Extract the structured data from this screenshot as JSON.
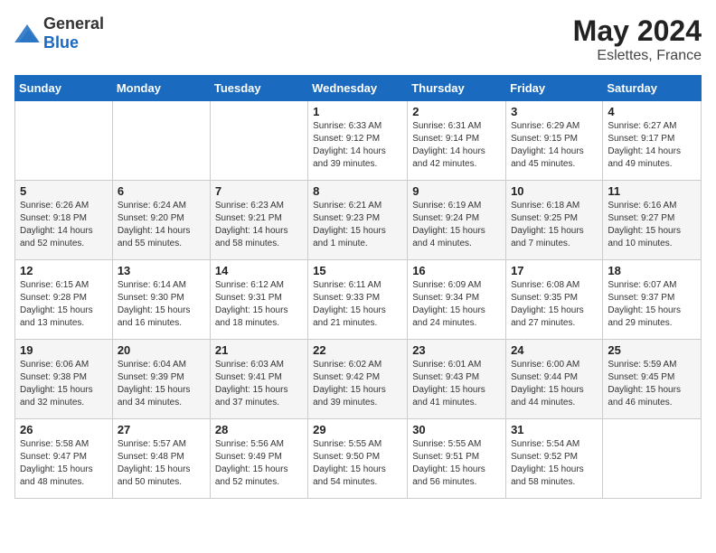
{
  "header": {
    "logo_general": "General",
    "logo_blue": "Blue",
    "title": "May 2024",
    "location": "Eslettes, France"
  },
  "days_of_week": [
    "Sunday",
    "Monday",
    "Tuesday",
    "Wednesday",
    "Thursday",
    "Friday",
    "Saturday"
  ],
  "weeks": [
    [
      {
        "day": "",
        "info": ""
      },
      {
        "day": "",
        "info": ""
      },
      {
        "day": "",
        "info": ""
      },
      {
        "day": "1",
        "info": "Sunrise: 6:33 AM\nSunset: 9:12 PM\nDaylight: 14 hours and 39 minutes."
      },
      {
        "day": "2",
        "info": "Sunrise: 6:31 AM\nSunset: 9:14 PM\nDaylight: 14 hours and 42 minutes."
      },
      {
        "day": "3",
        "info": "Sunrise: 6:29 AM\nSunset: 9:15 PM\nDaylight: 14 hours and 45 minutes."
      },
      {
        "day": "4",
        "info": "Sunrise: 6:27 AM\nSunset: 9:17 PM\nDaylight: 14 hours and 49 minutes."
      }
    ],
    [
      {
        "day": "5",
        "info": "Sunrise: 6:26 AM\nSunset: 9:18 PM\nDaylight: 14 hours and 52 minutes."
      },
      {
        "day": "6",
        "info": "Sunrise: 6:24 AM\nSunset: 9:20 PM\nDaylight: 14 hours and 55 minutes."
      },
      {
        "day": "7",
        "info": "Sunrise: 6:23 AM\nSunset: 9:21 PM\nDaylight: 14 hours and 58 minutes."
      },
      {
        "day": "8",
        "info": "Sunrise: 6:21 AM\nSunset: 9:23 PM\nDaylight: 15 hours and 1 minute."
      },
      {
        "day": "9",
        "info": "Sunrise: 6:19 AM\nSunset: 9:24 PM\nDaylight: 15 hours and 4 minutes."
      },
      {
        "day": "10",
        "info": "Sunrise: 6:18 AM\nSunset: 9:25 PM\nDaylight: 15 hours and 7 minutes."
      },
      {
        "day": "11",
        "info": "Sunrise: 6:16 AM\nSunset: 9:27 PM\nDaylight: 15 hours and 10 minutes."
      }
    ],
    [
      {
        "day": "12",
        "info": "Sunrise: 6:15 AM\nSunset: 9:28 PM\nDaylight: 15 hours and 13 minutes."
      },
      {
        "day": "13",
        "info": "Sunrise: 6:14 AM\nSunset: 9:30 PM\nDaylight: 15 hours and 16 minutes."
      },
      {
        "day": "14",
        "info": "Sunrise: 6:12 AM\nSunset: 9:31 PM\nDaylight: 15 hours and 18 minutes."
      },
      {
        "day": "15",
        "info": "Sunrise: 6:11 AM\nSunset: 9:33 PM\nDaylight: 15 hours and 21 minutes."
      },
      {
        "day": "16",
        "info": "Sunrise: 6:09 AM\nSunset: 9:34 PM\nDaylight: 15 hours and 24 minutes."
      },
      {
        "day": "17",
        "info": "Sunrise: 6:08 AM\nSunset: 9:35 PM\nDaylight: 15 hours and 27 minutes."
      },
      {
        "day": "18",
        "info": "Sunrise: 6:07 AM\nSunset: 9:37 PM\nDaylight: 15 hours and 29 minutes."
      }
    ],
    [
      {
        "day": "19",
        "info": "Sunrise: 6:06 AM\nSunset: 9:38 PM\nDaylight: 15 hours and 32 minutes."
      },
      {
        "day": "20",
        "info": "Sunrise: 6:04 AM\nSunset: 9:39 PM\nDaylight: 15 hours and 34 minutes."
      },
      {
        "day": "21",
        "info": "Sunrise: 6:03 AM\nSunset: 9:41 PM\nDaylight: 15 hours and 37 minutes."
      },
      {
        "day": "22",
        "info": "Sunrise: 6:02 AM\nSunset: 9:42 PM\nDaylight: 15 hours and 39 minutes."
      },
      {
        "day": "23",
        "info": "Sunrise: 6:01 AM\nSunset: 9:43 PM\nDaylight: 15 hours and 41 minutes."
      },
      {
        "day": "24",
        "info": "Sunrise: 6:00 AM\nSunset: 9:44 PM\nDaylight: 15 hours and 44 minutes."
      },
      {
        "day": "25",
        "info": "Sunrise: 5:59 AM\nSunset: 9:45 PM\nDaylight: 15 hours and 46 minutes."
      }
    ],
    [
      {
        "day": "26",
        "info": "Sunrise: 5:58 AM\nSunset: 9:47 PM\nDaylight: 15 hours and 48 minutes."
      },
      {
        "day": "27",
        "info": "Sunrise: 5:57 AM\nSunset: 9:48 PM\nDaylight: 15 hours and 50 minutes."
      },
      {
        "day": "28",
        "info": "Sunrise: 5:56 AM\nSunset: 9:49 PM\nDaylight: 15 hours and 52 minutes."
      },
      {
        "day": "29",
        "info": "Sunrise: 5:55 AM\nSunset: 9:50 PM\nDaylight: 15 hours and 54 minutes."
      },
      {
        "day": "30",
        "info": "Sunrise: 5:55 AM\nSunset: 9:51 PM\nDaylight: 15 hours and 56 minutes."
      },
      {
        "day": "31",
        "info": "Sunrise: 5:54 AM\nSunset: 9:52 PM\nDaylight: 15 hours and 58 minutes."
      },
      {
        "day": "",
        "info": ""
      }
    ]
  ]
}
